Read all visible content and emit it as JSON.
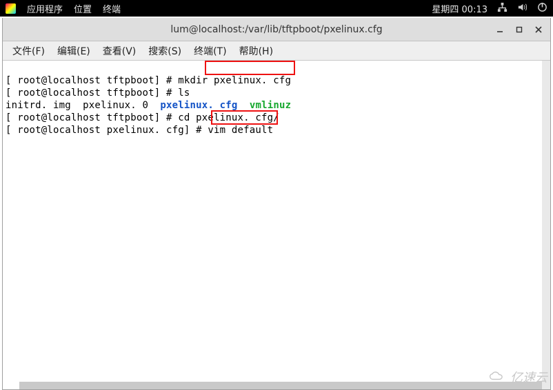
{
  "panel": {
    "apps": "应用程序",
    "places": "位置",
    "term": "终端",
    "clock": "星期四 00:13"
  },
  "window": {
    "title": "lum@localhost:/var/lib/tftpboot/pxelinux.cfg"
  },
  "menubar": {
    "file": "文件(F)",
    "edit": "编辑(E)",
    "view": "查看(V)",
    "search": "搜索(S)",
    "term": "终端(T)",
    "help": "帮助(H)"
  },
  "lines": {
    "l1_prompt": "[ root@localhost tftpboot] # ",
    "l1_cmd": "mkdir pxelinux. cfg",
    "l2_prompt": "[ root@localhost tftpboot] # ",
    "l2_cmd": "ls",
    "l3_a": "initrd. img  pxelinux. 0  ",
    "l3_b": "pxelinux. cfg",
    "l3_sp": "  ",
    "l3_c": "vmlinuz",
    "l4_prompt": "[ root@localhost tftpboot] # ",
    "l4_cmd": "cd pxelinux. cfg/",
    "l5_prompt": "[ root@localhost pxelinux. cfg] # ",
    "l5_cmd": "vim default"
  },
  "watermark": "亿速云"
}
